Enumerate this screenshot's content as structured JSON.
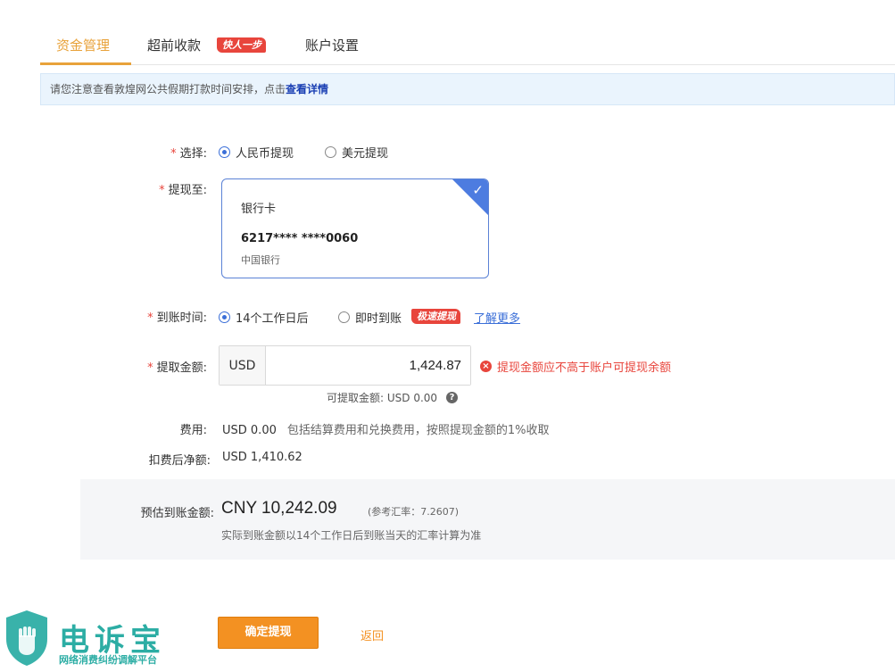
{
  "tabs": [
    {
      "label": "资金管理",
      "active": true
    },
    {
      "label": "超前收款",
      "badge": "快人一步"
    },
    {
      "label": "账户设置"
    }
  ],
  "notice": {
    "text": "请您注意查看敦煌网公共假期打款时间安排，点击",
    "link": "查看详情"
  },
  "form": {
    "select": {
      "label": "选择:",
      "options": [
        "人民币提现",
        "美元提现"
      ],
      "selected": "人民币提现"
    },
    "withdraw_to": {
      "label": "提现至:",
      "card": {
        "type": "银行卡",
        "number": "6217**** ****0060",
        "bank": "中国银行"
      }
    },
    "arrival": {
      "label": "到账时间:",
      "options": [
        "14个工作日后",
        "即时到账"
      ],
      "selected": "14个工作日后",
      "badge": "极速提现",
      "more_link": "了解更多"
    },
    "amount": {
      "label": "提取金额:",
      "currency": "USD",
      "value": "1,424.87",
      "error": "提现金额应不高于账户可提现余额",
      "available": "可提取金额: USD 0.00"
    },
    "fee": {
      "label": "费用:",
      "value": "USD 0.00",
      "note": "包括结算费用和兑换费用，按照提现金额的1%收取"
    },
    "net": {
      "label": "扣费后净额:",
      "value": "USD 1,410.62"
    }
  },
  "estimate": {
    "label": "预估到账金额:",
    "amount": "CNY 10,242.09",
    "rate": "(参考汇率：7.2607)",
    "note": "实际到账金额以14个工作日后到账当天的汇率计算为准"
  },
  "actions": {
    "confirm": "确定提现",
    "back": "返回"
  },
  "watermark": {
    "title": "电诉宝",
    "subtitle": "网络消费纠纷调解平台"
  },
  "colors": {
    "accent": "#e8a23a",
    "primary_button": "#f39122",
    "error": "#e8453c",
    "radio": "#3b6fd8"
  }
}
